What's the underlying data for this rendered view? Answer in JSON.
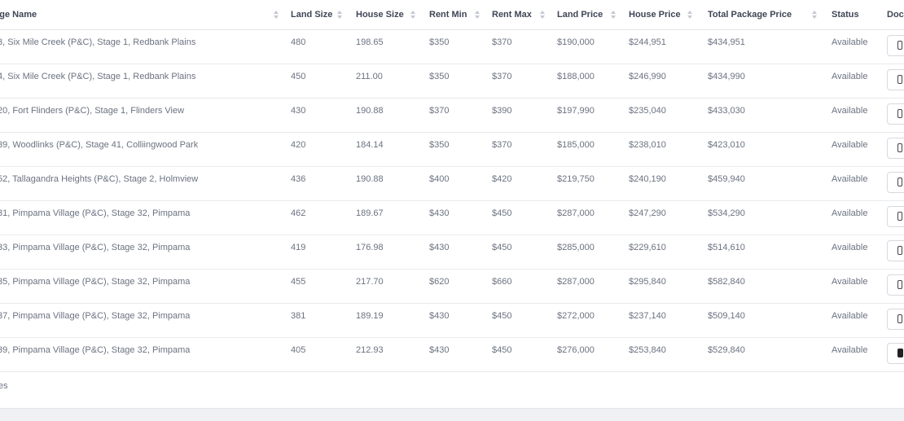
{
  "table": {
    "headers": {
      "stage_name": "Stage Name",
      "stage_name_clipped": "e Stage Name",
      "land_size": "Land Size",
      "house_size": "House Size",
      "rent_min": "Rent Min",
      "rent_max": "Rent Max",
      "land_price": "Land Price",
      "house_price": "House Price",
      "total_package_price": "Total Package Price",
      "status": "Status",
      "documents_clipped": "Doc"
    },
    "rows": [
      {
        "stage_name": "3, Six Mile Creek (P&C), Stage 1, Redbank Plains",
        "land_size": "480",
        "house_size": "198.65",
        "rent_min": "$350",
        "rent_max": "$370",
        "land_price": "$190,000",
        "house_price": "$244,951",
        "total_package_price": "$434,951",
        "status": "Available"
      },
      {
        "stage_name": "4, Six Mile Creek (P&C), Stage 1, Redbank Plains",
        "land_size": "450",
        "house_size": "211.00",
        "rent_min": "$350",
        "rent_max": "$370",
        "land_price": "$188,000",
        "house_price": "$246,990",
        "total_package_price": "$434,990",
        "status": "Available"
      },
      {
        "stage_name": "20, Fort Flinders (P&C), Stage 1, Flinders View",
        "land_size": "430",
        "house_size": "190.88",
        "rent_min": "$370",
        "rent_max": "$390",
        "land_price": "$197,990",
        "house_price": "$235,040",
        "total_package_price": "$433,030",
        "status": "Available"
      },
      {
        "stage_name": "39, Woodlinks (P&C), Stage 41, Colliingwood Park",
        "land_size": "420",
        "house_size": "184.14",
        "rent_min": "$350",
        "rent_max": "$370",
        "land_price": "$185,000",
        "house_price": "$238,010",
        "total_package_price": "$423,010",
        "status": "Available"
      },
      {
        "stage_name": "52, Tallagandra Heights (P&C), Stage 2, Holmview",
        "land_size": "436",
        "house_size": "190.88",
        "rent_min": "$400",
        "rent_max": "$420",
        "land_price": "$219,750",
        "house_price": "$240,190",
        "total_package_price": "$459,940",
        "status": "Available"
      },
      {
        "stage_name": "31, Pimpama Village (P&C), Stage 32, Pimpama",
        "land_size": "462",
        "house_size": "189.67",
        "rent_min": "$430",
        "rent_max": "$450",
        "land_price": "$287,000",
        "house_price": "$247,290",
        "total_package_price": "$534,290",
        "status": "Available"
      },
      {
        "stage_name": "33, Pimpama Village (P&C), Stage 32, Pimpama",
        "land_size": "419",
        "house_size": "176.98",
        "rent_min": "$430",
        "rent_max": "$450",
        "land_price": "$285,000",
        "house_price": "$229,610",
        "total_package_price": "$514,610",
        "status": "Available"
      },
      {
        "stage_name": "35, Pimpama Village (P&C), Stage 32, Pimpama",
        "land_size": "455",
        "house_size": "217.70",
        "rent_min": "$620",
        "rent_max": "$660",
        "land_price": "$287,000",
        "house_price": "$295,840",
        "total_package_price": "$582,840",
        "status": "Available"
      },
      {
        "stage_name": "37, Pimpama Village (P&C), Stage 32, Pimpama",
        "land_size": "381",
        "house_size": "189.19",
        "rent_min": "$430",
        "rent_max": "$450",
        "land_price": "$272,000",
        "house_price": "$237,140",
        "total_package_price": "$509,140",
        "status": "Available"
      },
      {
        "stage_name": "39, Pimpama Village (P&C), Stage 32, Pimpama",
        "land_size": "405",
        "house_size": "212.93",
        "rent_min": "$430",
        "rent_max": "$450",
        "land_price": "$276,000",
        "house_price": "$253,840",
        "total_package_price": "$529,840",
        "status": "Available"
      }
    ]
  },
  "footer": {
    "text": "es"
  }
}
